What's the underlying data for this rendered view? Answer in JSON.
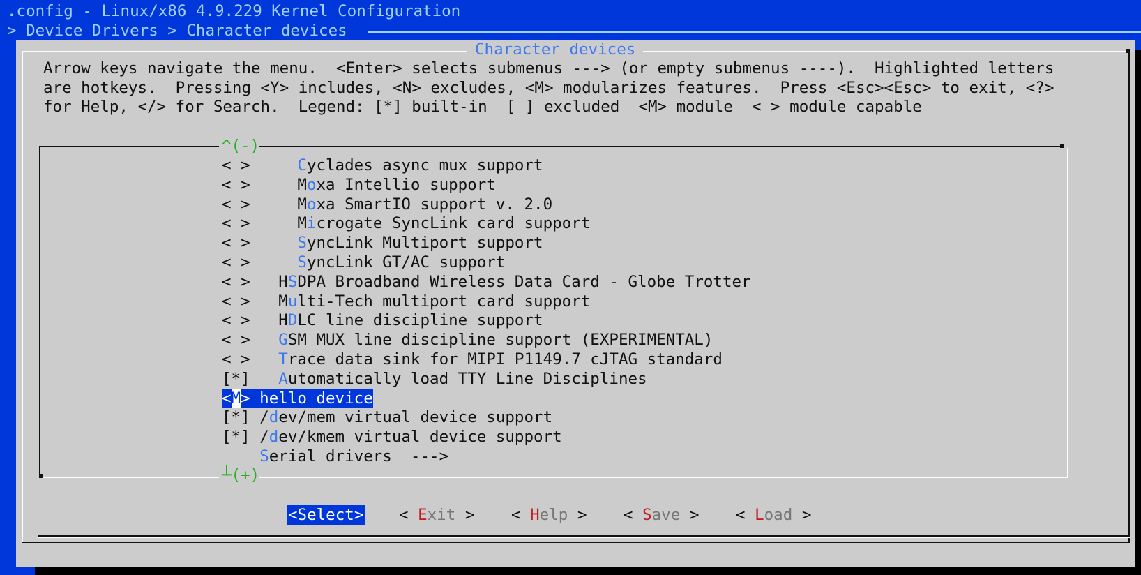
{
  "window": {
    "title": ".config - Linux/x86 4.9.229 Kernel Configuration",
    "breadcrumb": "> Device Drivers > Character devices"
  },
  "dialog": {
    "title": "Character devices",
    "help_lines": [
      "Arrow keys navigate the menu.  <Enter> selects submenus ---> (or empty submenus ----).  Highlighted letters",
      "are hotkeys.  Pressing <Y> includes, <N> excludes, <M> modularizes features.  Press <Esc><Esc> to exit, <?>",
      "for Help, </> for Search.  Legend: [*] built-in  [ ] excluded  <M> module  < > module capable"
    ],
    "scroll_up": "^(-)",
    "scroll_down": "┴(+)"
  },
  "menu": {
    "items": [
      {
        "state": "< >",
        "indent": "     ",
        "hotkey": "C",
        "pre": "",
        "post": "yclades async mux support"
      },
      {
        "state": "< >",
        "indent": "     ",
        "hotkey": "o",
        "pre": "M",
        "post": "xa Intellio support"
      },
      {
        "state": "< >",
        "indent": "     ",
        "hotkey": "o",
        "pre": "M",
        "post": "xa SmartIO support v. 2.0"
      },
      {
        "state": "< >",
        "indent": "     ",
        "hotkey": "i",
        "pre": "M",
        "post": "crogate SyncLink card support"
      },
      {
        "state": "< >",
        "indent": "     ",
        "hotkey": "S",
        "pre": "",
        "post": "yncLink Multiport support"
      },
      {
        "state": "< >",
        "indent": "     ",
        "hotkey": "S",
        "pre": "",
        "post": "yncLink GT/AC support"
      },
      {
        "state": "< >",
        "indent": "   ",
        "hotkey": "S",
        "pre": "H",
        "post": "DPA Broadband Wireless Data Card - Globe Trotter"
      },
      {
        "state": "< >",
        "indent": "   ",
        "hotkey": "u",
        "pre": "M",
        "post": "lti-Tech multiport card support"
      },
      {
        "state": "< >",
        "indent": "   ",
        "hotkey": "D",
        "pre": "H",
        "post": "LC line discipline support"
      },
      {
        "state": "< >",
        "indent": "   ",
        "hotkey": "G",
        "pre": "",
        "post": "SM MUX line discipline support (EXPERIMENTAL)"
      },
      {
        "state": "< >",
        "indent": "   ",
        "hotkey": "T",
        "pre": "",
        "post": "race data sink for MIPI P1149.7 cJTAG standard"
      },
      {
        "state": "[*]",
        "indent": "   ",
        "hotkey": "A",
        "pre": "",
        "post": "utomatically load TTY Line Disciplines"
      },
      {
        "state": "<M>",
        "indent": " ",
        "hotkey": "",
        "pre": "hello device",
        "post": "",
        "selected": true
      },
      {
        "state": "[*]",
        "indent": " ",
        "hotkey": "d",
        "pre": "/",
        "post": "ev/mem virtual device support"
      },
      {
        "state": "[*]",
        "indent": " ",
        "hotkey": "d",
        "pre": "/",
        "post": "ev/kmem virtual device support"
      },
      {
        "state": "   ",
        "indent": " ",
        "hotkey": "S",
        "pre": "",
        "post": "erial drivers  --->"
      }
    ]
  },
  "buttons": [
    {
      "label": "<Select>",
      "selected": true
    },
    {
      "open": "< ",
      "hotkey": "E",
      "rest": "xit",
      "close": " >"
    },
    {
      "open": "< ",
      "hotkey": "H",
      "rest": "elp",
      "close": " >"
    },
    {
      "open": "< ",
      "hotkey": "S",
      "rest": "ave",
      "close": " >"
    },
    {
      "open": "< ",
      "hotkey": "L",
      "rest": "oad",
      "close": " >"
    }
  ]
}
